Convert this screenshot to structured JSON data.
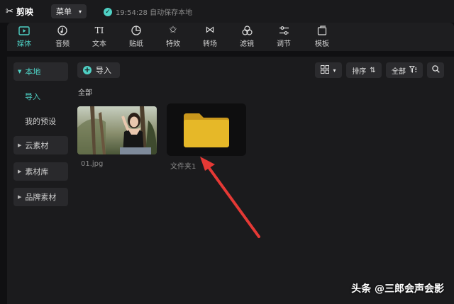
{
  "app": {
    "name": "剪映",
    "menu_label": "菜单",
    "autosave_status": "19:54:28 自动保存本地"
  },
  "toolbar": {
    "items": [
      {
        "label": "媒体",
        "icon": "media-icon",
        "active": true
      },
      {
        "label": "音频",
        "icon": "audio-icon",
        "active": false
      },
      {
        "label": "文本",
        "icon": "text-icon",
        "active": false
      },
      {
        "label": "贴纸",
        "icon": "sticker-icon",
        "active": false
      },
      {
        "label": "特效",
        "icon": "effects-icon",
        "active": false
      },
      {
        "label": "转场",
        "icon": "transition-icon",
        "active": false
      },
      {
        "label": "滤镜",
        "icon": "filter-icon",
        "active": false
      },
      {
        "label": "调节",
        "icon": "adjust-icon",
        "active": false
      },
      {
        "label": "模板",
        "icon": "template-icon",
        "active": false
      }
    ]
  },
  "sidebar": {
    "items": [
      {
        "label": "本地",
        "expanded": true,
        "selected": true
      },
      {
        "label": "导入",
        "sub": true,
        "selected": true
      },
      {
        "label": "我的预设",
        "sub": true
      },
      {
        "label": "云素材"
      },
      {
        "label": "素材库"
      },
      {
        "label": "品牌素材"
      }
    ]
  },
  "main": {
    "import_label": "导入",
    "view_toggle_icon": "grid-view-icon",
    "sort_label": "排序",
    "filter_label": "全部",
    "search_icon": "search-icon",
    "section_label": "全部",
    "assets": [
      {
        "name": "01.jpg",
        "type": "image"
      },
      {
        "name": "文件夹1",
        "type": "folder"
      }
    ]
  },
  "watermark": "头条 @三郎会声会影",
  "colors": {
    "accent": "#4fd1c5",
    "folder": "#e6b828",
    "arrow": "#e53935"
  }
}
